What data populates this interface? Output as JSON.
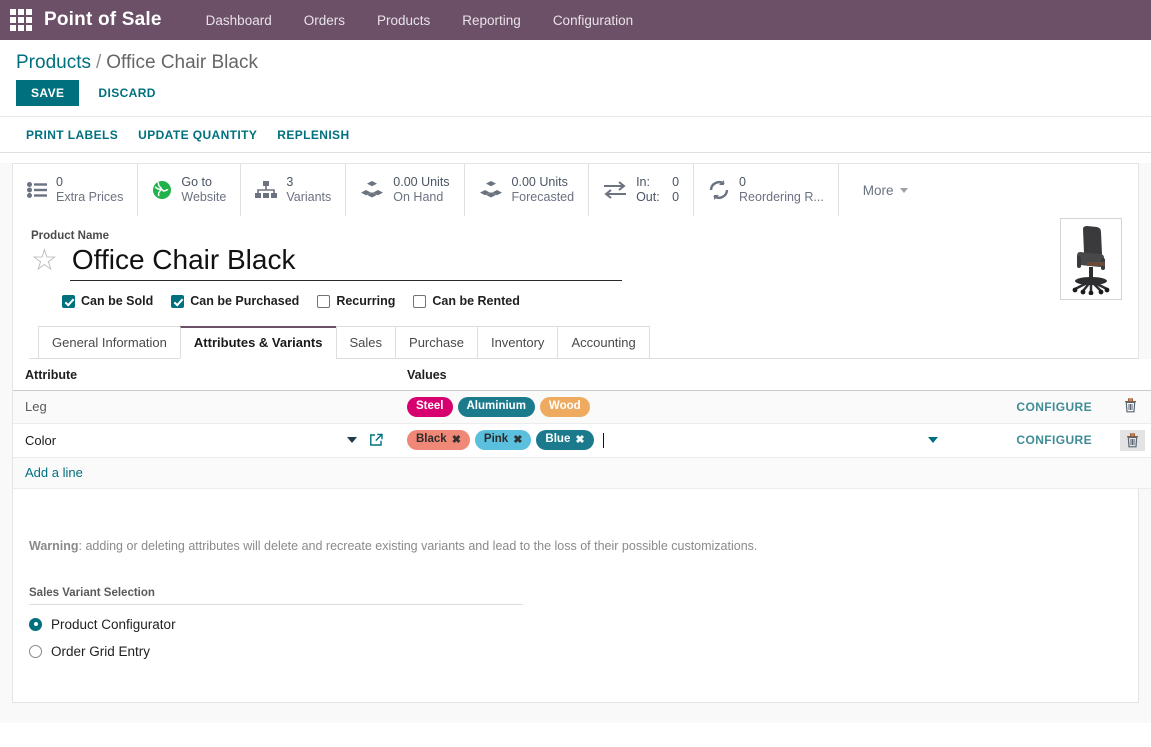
{
  "navbar": {
    "apps_icon": "apps-grid-icon",
    "brand": "Point of Sale",
    "links": [
      {
        "label": "Dashboard"
      },
      {
        "label": "Orders"
      },
      {
        "label": "Products"
      },
      {
        "label": "Reporting"
      },
      {
        "label": "Configuration"
      }
    ]
  },
  "control_panel": {
    "breadcrumb": {
      "root": "Products",
      "separator": "/",
      "current": "Office Chair Black"
    },
    "save_label": "SAVE",
    "discard_label": "DISCARD",
    "sub_buttons": [
      {
        "label": "PRINT LABELS"
      },
      {
        "label": "UPDATE QUANTITY"
      },
      {
        "label": "REPLENISH"
      }
    ]
  },
  "stat_buttons": [
    {
      "icon": "list-icon",
      "value": "0",
      "label": "Extra Prices"
    },
    {
      "icon": "globe-icon",
      "value": "Go to",
      "label": "Website"
    },
    {
      "icon": "sitemap-icon",
      "value": "3",
      "label": "Variants"
    },
    {
      "icon": "cubes-icon",
      "value": "0.00 Units",
      "label": "On Hand"
    },
    {
      "icon": "cubes-icon",
      "value": "0.00 Units",
      "label": "Forecasted"
    },
    {
      "icon": "exchange-icon",
      "in_label": "In:",
      "in_value": "0",
      "out_label": "Out:",
      "out_value": "0"
    },
    {
      "icon": "refresh-icon",
      "value": "0",
      "label": "Reordering R..."
    }
  ],
  "stat_more": {
    "label": "More",
    "icon": "caret-down-icon"
  },
  "product": {
    "name_field_label": "Product Name",
    "name_value": "Office Chair Black",
    "favorite_icon": "star-outline-icon",
    "image_alt": "product-thumbnail-office-chair",
    "checkboxes": [
      {
        "label": "Can be Sold",
        "checked": true
      },
      {
        "label": "Can be Purchased",
        "checked": true
      },
      {
        "label": "Recurring",
        "checked": false
      },
      {
        "label": "Can be Rented",
        "checked": false
      }
    ]
  },
  "tabs": [
    {
      "label": "General Information",
      "active": false
    },
    {
      "label": "Attributes & Variants",
      "active": true
    },
    {
      "label": "Sales",
      "active": false
    },
    {
      "label": "Purchase",
      "active": false
    },
    {
      "label": "Inventory",
      "active": false
    },
    {
      "label": "Accounting",
      "active": false
    }
  ],
  "attributes_table": {
    "headers": {
      "attribute": "Attribute",
      "values": "Values"
    },
    "optional_columns_icon": "vertical-dots-icon",
    "rows": [
      {
        "attribute": "Leg",
        "editing": false,
        "values": [
          {
            "label": "Steel",
            "color": "#d6006f",
            "text_color": "#ffffff",
            "removable": false
          },
          {
            "label": "Aluminium",
            "color": "#1b7b8c",
            "text_color": "#ffffff",
            "removable": false
          },
          {
            "label": "Wood",
            "color": "#eeab5f",
            "text_color": "#ffffff",
            "removable": false
          }
        ],
        "configure_label": "CONFIGURE",
        "delete_icon": "trash-icon"
      },
      {
        "attribute": "Color",
        "editing": true,
        "values": [
          {
            "label": "Black",
            "color": "#f08878",
            "text_color": "#2b2b2b",
            "removable": true,
            "remove_icon": "x-icon"
          },
          {
            "label": "Pink",
            "color": "#5bc0de",
            "text_color": "#2b2b2b",
            "removable": true,
            "remove_icon": "x-icon"
          },
          {
            "label": "Blue",
            "color": "#1b7b8c",
            "text_color": "#ffffff",
            "removable": true,
            "remove_icon": "x-icon"
          }
        ],
        "configure_label": "CONFIGURE",
        "delete_icon": "trash-icon",
        "external_link_icon": "external-link-icon",
        "dropdown_icon": "caret-down-icon"
      }
    ],
    "add_line_label": "Add a line"
  },
  "warning": {
    "prefix": "Warning",
    "text": ": adding or deleting attributes will delete and recreate existing variants and lead to the loss of their possible customizations."
  },
  "sales_variant_selection": {
    "title": "Sales Variant Selection",
    "options": [
      {
        "label": "Product Configurator",
        "selected": true
      },
      {
        "label": "Order Grid Entry",
        "selected": false
      }
    ]
  },
  "colors": {
    "brand_purple": "#6b5068",
    "accent_teal": "#00707f"
  }
}
